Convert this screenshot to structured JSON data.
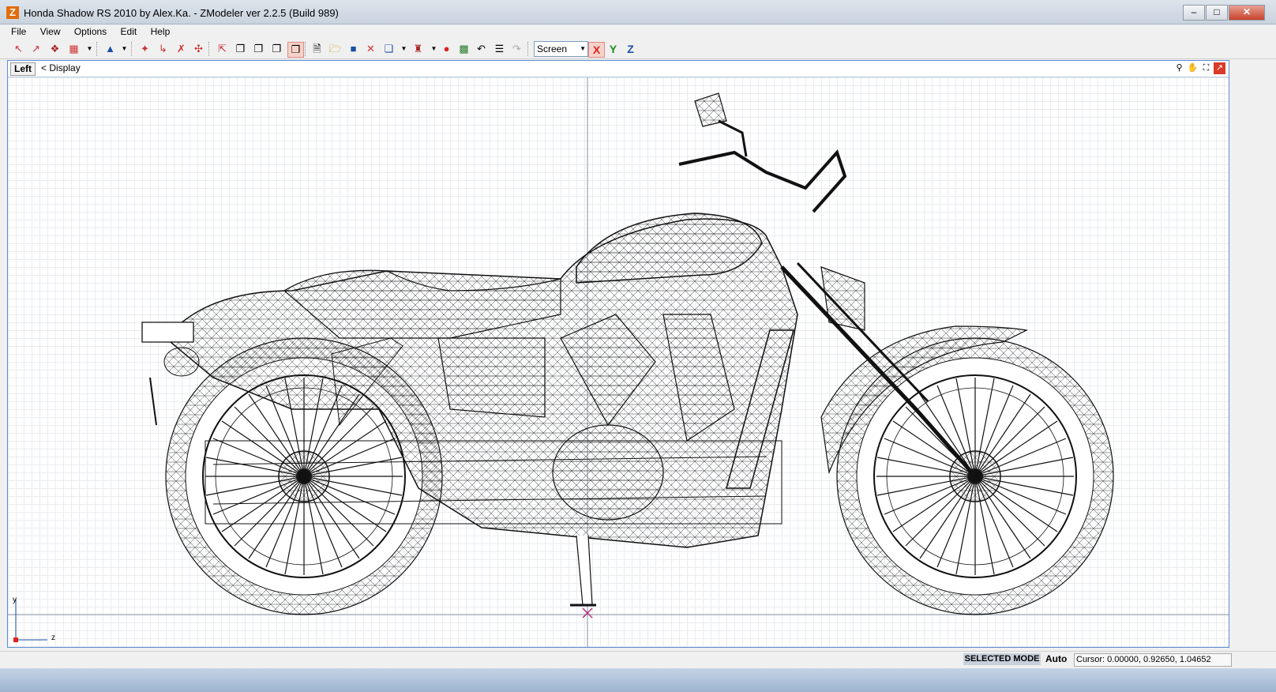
{
  "window": {
    "title": "Honda Shadow RS  2010 by Alex.Ka. - ZModeler ver 2.2.5 (Build 989)",
    "app_icon": "Z"
  },
  "menu": [
    "File",
    "View",
    "Options",
    "Edit",
    "Help"
  ],
  "toolbar": {
    "coord_mode": "Screen",
    "axes": [
      "X",
      "Y",
      "Z"
    ]
  },
  "viewport": {
    "tab": "Left",
    "label": "< Display",
    "axis_y": "y",
    "axis_z": "z"
  },
  "status": {
    "mode": "SELECTED MODE",
    "auto": "Auto",
    "cursor": "Cursor: 0.00000, 0.92650, 1.04652"
  },
  "colors": {
    "accent": "#5f8dd3",
    "wire": "#111111",
    "close": "#c7432c"
  }
}
